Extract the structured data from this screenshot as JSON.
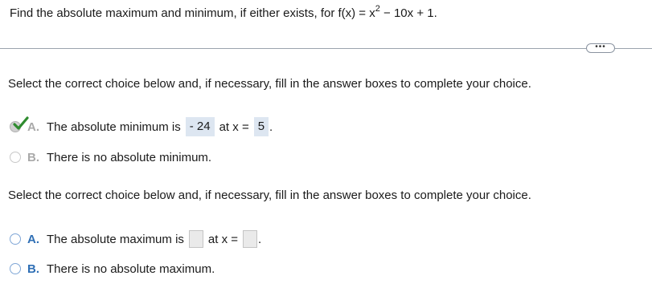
{
  "question": {
    "prefix": "Find the absolute maximum and minimum, if either exists, for f(x) = x",
    "exponent": "2",
    "suffix": " − 10x + 1."
  },
  "more_button_label": "•••",
  "part1": {
    "instruction": "Select the correct choice below and, if necessary, fill in the answer boxes to complete your choice.",
    "choice_a": {
      "letter": "A.",
      "text_before": "The absolute minimum is",
      "value": "- 24",
      "text_middle": "at x =",
      "x_value": "5",
      "text_after": ".",
      "selected": true,
      "correct": true
    },
    "choice_b": {
      "letter": "B.",
      "text": "There is no absolute minimum.",
      "selected": false
    }
  },
  "part2": {
    "instruction": "Select the correct choice below and, if necessary, fill in the answer boxes to complete your choice.",
    "choice_a": {
      "letter": "A.",
      "text_before": "The absolute maximum is",
      "value": "",
      "text_middle": "at x =",
      "x_value": "",
      "text_after": ".",
      "selected": false
    },
    "choice_b": {
      "letter": "B.",
      "text": "There is no absolute maximum.",
      "selected": false
    }
  },
  "colors": {
    "letter_active": "#2f6fb5",
    "letter_dim": "#a9a9a9",
    "answer_fill": "#dde6f1",
    "check_green": "#2e8b2e"
  }
}
